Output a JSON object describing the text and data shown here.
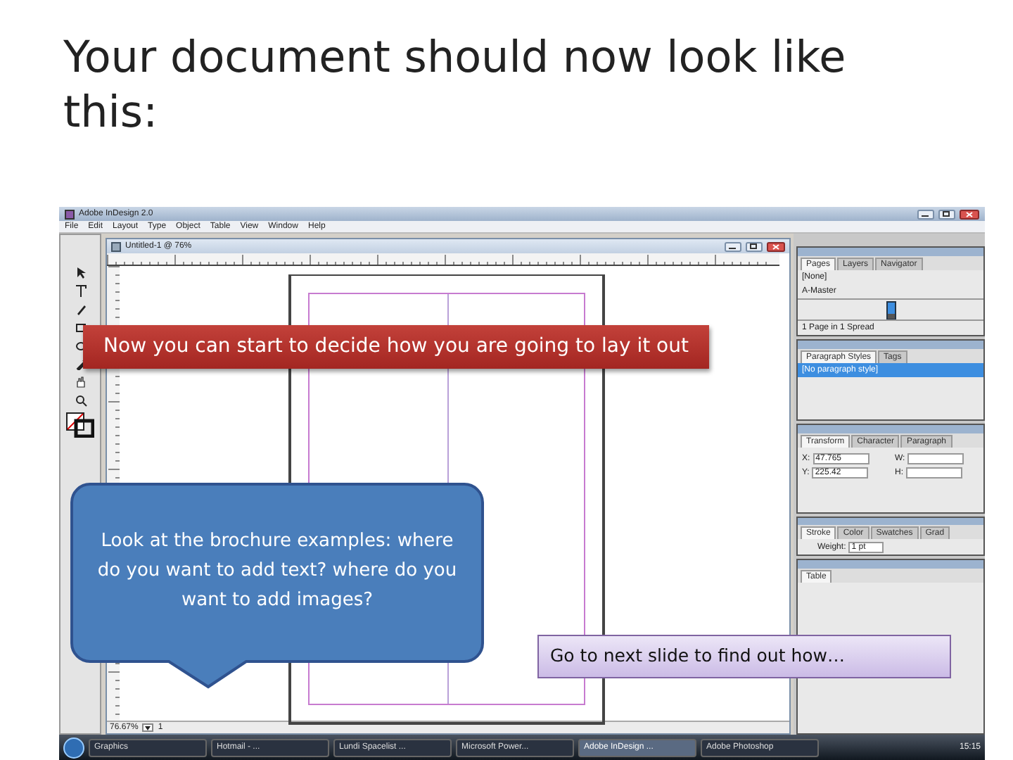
{
  "slide": {
    "title": "Your document should now look like this:"
  },
  "app": {
    "title": "Adobe InDesign 2.0",
    "menu": [
      "File",
      "Edit",
      "Layout",
      "Type",
      "Object",
      "Table",
      "View",
      "Window",
      "Help"
    ],
    "document": {
      "title": "Untitled-1 @ 76%",
      "zoom": "76.67%",
      "page": "1"
    },
    "panels": [
      {
        "kind": "pages",
        "tabs": [
          {
            "label": "Pages",
            "selected": true
          },
          {
            "label": "Layers",
            "selected": false
          },
          {
            "label": "Navigator",
            "selected": false
          }
        ],
        "items": [
          {
            "label": "[None]",
            "selected": false
          },
          {
            "label": "A-Master",
            "selected": false
          }
        ],
        "footer": "1 Page in 1 Spread"
      },
      {
        "kind": "styles",
        "tabs": [
          {
            "label": "Paragraph Styles",
            "selected": true
          },
          {
            "label": "Tags",
            "selected": false
          }
        ],
        "items": [
          {
            "label": "[No paragraph style]",
            "selected": true
          }
        ]
      },
      {
        "kind": "transform",
        "tabs": [
          {
            "label": "Transform",
            "selected": true
          },
          {
            "label": "Character",
            "selected": false
          },
          {
            "label": "Paragraph",
            "selected": false
          }
        ],
        "fields": [
          {
            "label": "X:",
            "value": "47.765"
          },
          {
            "label": "W:"
          },
          {
            "label": "Y:",
            "value": "225.42"
          },
          {
            "label": "H:"
          }
        ]
      },
      {
        "kind": "stroke",
        "tabs": [
          {
            "label": "Stroke",
            "selected": true
          },
          {
            "label": "Color",
            "selected": false
          },
          {
            "label": "Swatches",
            "selected": false
          },
          {
            "label": "Grad",
            "selected": false
          }
        ],
        "weight_label": "Weight:",
        "weight": "1 pt"
      },
      {
        "kind": "table",
        "tabs": [
          {
            "label": "Table",
            "selected": true
          }
        ]
      }
    ],
    "taskbar": {
      "items": [
        {
          "label": "Graphics",
          "selected": false
        },
        {
          "label": "Hotmail - ...",
          "selected": false
        },
        {
          "label": "Lundi Spacelist ...",
          "selected": false
        },
        {
          "label": "Microsoft Power...",
          "selected": false
        },
        {
          "label": "Adobe InDesign ...",
          "selected": true
        },
        {
          "label": "Adobe Photoshop",
          "selected": false
        }
      ],
      "clock": "15:15"
    }
  },
  "callouts": [
    {
      "kind": "banner",
      "text": "Now you can start to decide how you are going to lay it out"
    },
    {
      "kind": "bubble",
      "text": "Look at the brochure examples: where do you want to add text? where do you want to add images?"
    },
    {
      "kind": "note",
      "text": "Go to next slide to find out how…"
    }
  ]
}
